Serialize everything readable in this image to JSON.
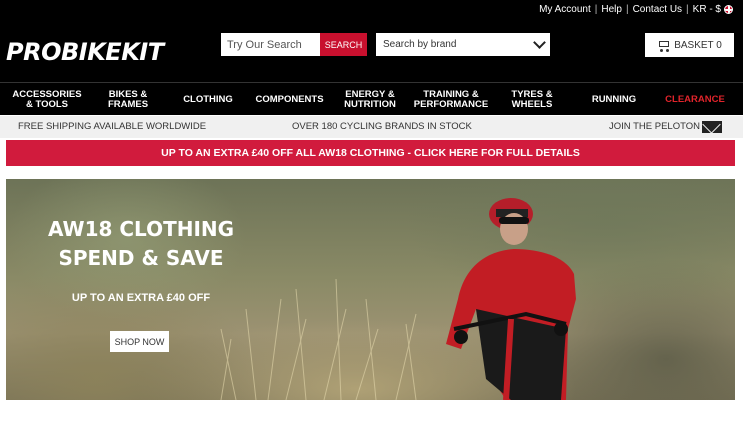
{
  "header": {
    "logo": "PROBIKEKIT",
    "top_links": [
      "My Account",
      "Help",
      "Contact Us",
      "KR - $"
    ],
    "search": {
      "placeholder": "Try Our Search",
      "button_label": "SEARCH"
    },
    "brand_select": {
      "selected": "Search by brand"
    },
    "basket": {
      "label": "BASKET 0"
    }
  },
  "nav": {
    "items": [
      {
        "label": "ACCESSORIES & TOOLS"
      },
      {
        "label": "BIKES & FRAMES"
      },
      {
        "label": "CLOTHING"
      },
      {
        "label": "COMPONENTS"
      },
      {
        "label": "ENERGY & NUTRITION"
      },
      {
        "label": "TRAINING & PERFORMANCE"
      },
      {
        "label": "TYRES & WHEELS"
      },
      {
        "label": "RUNNING"
      },
      {
        "label": "CLEARANCE"
      }
    ]
  },
  "info_bar": {
    "left": "FREE SHIPPING AVAILABLE WORLDWIDE",
    "center": "OVER 180 CYCLING BRANDS IN STOCK",
    "right": "JOIN THE PELOTON"
  },
  "promo": {
    "text": "UP TO AN EXTRA £40 OFF ALL AW18  CLOTHING - CLICK HERE FOR FULL DETAILS"
  },
  "hero": {
    "title_line1": "AW18 CLOTHING",
    "title_line2": "SPEND & SAVE",
    "subtitle": "UP TO AN EXTRA £40 OFF",
    "cta": "SHOP NOW"
  },
  "colors": {
    "accent": "#d11b3d",
    "clearance": "#e1242b",
    "header_bg": "#000000"
  }
}
